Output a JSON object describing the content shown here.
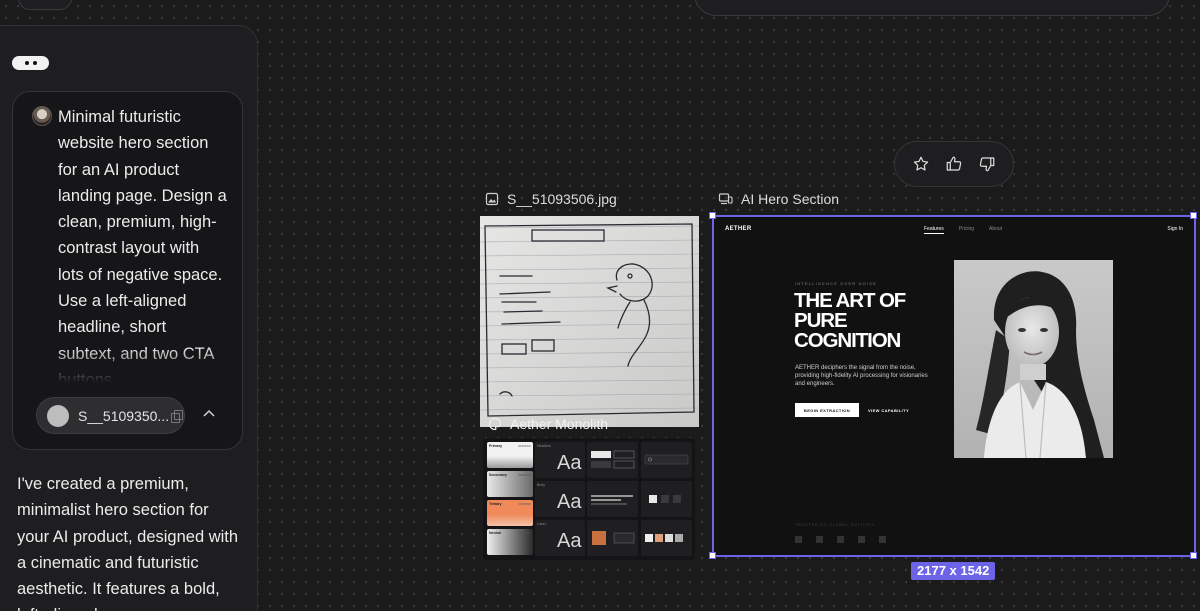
{
  "chat": {
    "prompt_text": "Minimal futuristic website hero section for an AI product landing page. Design a clean, premium, high-contrast layout with lots of negative space. Use a left-aligned headline, short subtext, and two CTA buttons",
    "attachment_name": "S__5109350...",
    "response_text": "I've created a premium, minimalist hero section for your AI product, designed with a cinematic and futuristic aesthetic. It features a bold, left-aligned"
  },
  "canvas": {
    "image_node_label": "S__51093506.jpg",
    "design_node_label": "Aether Monolith",
    "hero_node_label": "AI Hero Section",
    "dimensions": "2177 x 1542"
  },
  "design_system": {
    "swatches": [
      {
        "name": "Primary",
        "hex": "#FFFFFF",
        "color": "#f2f2f2"
      },
      {
        "name": "Secondary",
        "hex": "#E5E5E5",
        "color": "#d8d8d8"
      },
      {
        "name": "Tertiary",
        "hex": "#FF6B35",
        "color": "#f08a5a"
      },
      {
        "name": "Neutral",
        "hex": "#000000",
        "color": "#e0e0e0"
      }
    ],
    "type_labels": [
      "Headline",
      "Body",
      "Label"
    ],
    "type_sample": "Aa"
  },
  "hero": {
    "logo": "AETHER",
    "nav": [
      "Features",
      "Pricing",
      "About"
    ],
    "signin": "Sign In",
    "eyebrow": "INTELLIGENCE OVER NOISE",
    "title_lines": [
      "THE ART OF",
      "PURE",
      "COGNITION"
    ],
    "subtext": "AETHER deciphers the signal from the noise, providing high-fidelity AI processing for visionaries and engineers.",
    "primary_cta": "BEGIN EXTRACTION",
    "secondary_cta": "VIEW CAPABILITY",
    "trusted": "TRUSTED BY GLOBAL ENTITIES"
  },
  "colors": {
    "canvas_bg": "#1b1b1c",
    "selection": "#6c63e6",
    "accent_orange": "#f08a5a"
  },
  "icons": [
    "star-icon",
    "thumbs-up-icon",
    "thumbs-down-icon",
    "image-icon",
    "devices-icon",
    "palette-icon",
    "chevron-up-icon",
    "copy-icon"
  ]
}
